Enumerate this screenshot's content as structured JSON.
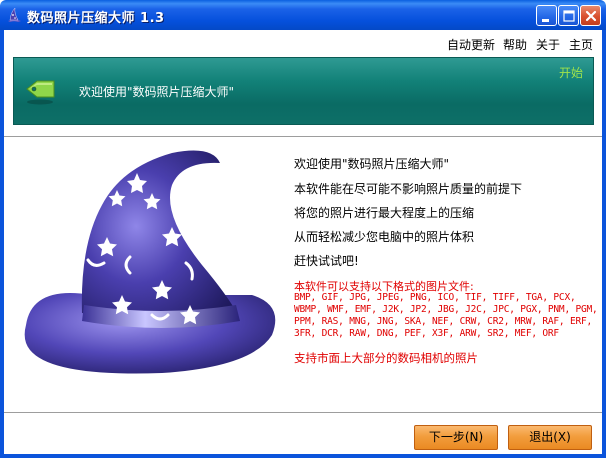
{
  "window": {
    "title": "数码照片压缩大师  1.3",
    "controls": [
      "minimize",
      "maximize",
      "close"
    ]
  },
  "menu": {
    "items": [
      "自动更新",
      "帮助",
      "关于",
      "主页"
    ]
  },
  "banner": {
    "icon": "price-tag-icon",
    "text": "欢迎使用\"数码照片压缩大师\"",
    "start_label": "开始"
  },
  "intro": {
    "lines": [
      "欢迎使用\"数码照片压缩大师\"",
      "本软件能在尽可能不影响照片质量的前提下",
      "将您的照片进行最大程度上的压缩",
      "从而轻松减少您电脑中的照片体积",
      "赶快试试吧!"
    ]
  },
  "formats": {
    "title": "本软件可以支持以下格式的图片文件:",
    "lines": [
      "BMP, GIF, JPG, JPEG, PNG, ICO, TIF, TIFF, TGA, PCX,",
      "WBMP, WMF, EMF, J2K, JP2, JBG, J2C, JPC, PGX, PNM, PGM,",
      "PPM, RAS, MNG, JNG, SKA, NEF, CRW, CR2, MRW, RAF, ERF,",
      "3FR, DCR, RAW, DNG, PEF, X3F, ARW, SR2, MEF, ORF"
    ],
    "camera_note": "支持市面上大部分的数码相机的照片"
  },
  "buttons": {
    "next_label": "下一步(N)",
    "exit_label": "退出(X)"
  },
  "colors": {
    "titlebar": "#0550dc",
    "banner": "#0a6b64",
    "accent_green": "#9fe34b",
    "format_red": "#e00000",
    "button_orange": "#f29d3d"
  },
  "illustration": "wizard-hat-icon"
}
